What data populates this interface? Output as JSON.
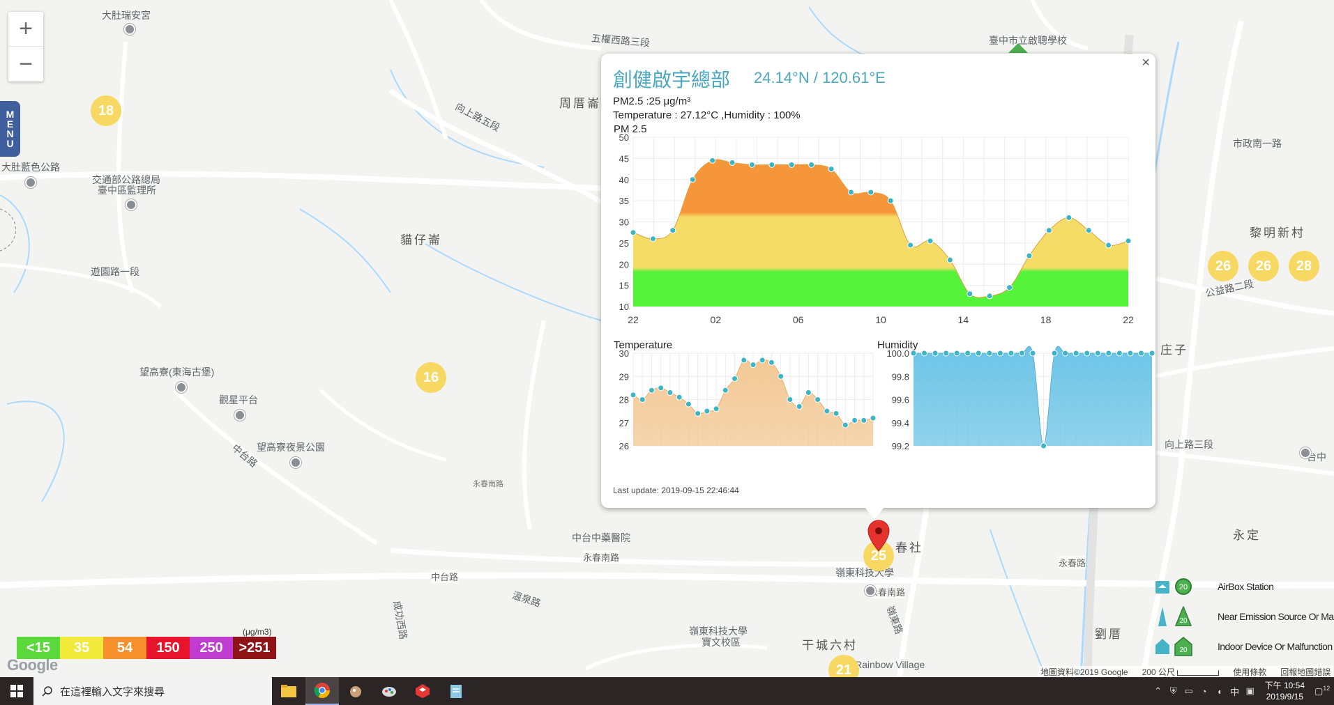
{
  "map": {
    "labels": [
      {
        "text": "大肚瑞安宮",
        "cls": ""
      },
      {
        "text": "周厝崙",
        "cls": "big"
      },
      {
        "text": "五權西路三段",
        "cls": ""
      },
      {
        "text": "臺中市立啟聰學校",
        "cls": ""
      },
      {
        "text": "向上路五段",
        "cls": ""
      },
      {
        "text": "大肚藍色公路",
        "cls": ""
      },
      {
        "text": "交通部公路總局",
        "cls": ""
      },
      {
        "text": "臺中區監理所",
        "cls": ""
      },
      {
        "text": "貓仔崙",
        "cls": "big"
      },
      {
        "text": "遊園路一段",
        "cls": ""
      },
      {
        "text": "望高寮(東海古堡)",
        "cls": ""
      },
      {
        "text": "觀星平台",
        "cls": ""
      },
      {
        "text": "望高寮夜景公園",
        "cls": ""
      },
      {
        "text": "中台路",
        "cls": ""
      },
      {
        "text": "永春南路",
        "cls": ""
      },
      {
        "text": "中台路",
        "cls": ""
      },
      {
        "text": "永春南路",
        "cls": ""
      },
      {
        "text": "春社",
        "cls": "big"
      },
      {
        "text": "嶺東科技大學",
        "cls": ""
      },
      {
        "text": "永春南路",
        "cls": ""
      },
      {
        "text": "嶺東科技大學",
        "cls": ""
      },
      {
        "text": "寶文校區",
        "cls": ""
      },
      {
        "text": "干城六村",
        "cls": "big"
      },
      {
        "text": "Rainbow Village",
        "cls": ""
      },
      {
        "text": "黎明新村",
        "cls": "big"
      },
      {
        "text": "永定",
        "cls": "big"
      },
      {
        "text": "劉厝",
        "cls": "big"
      },
      {
        "text": "庄子",
        "cls": "big"
      },
      {
        "text": "向上路三段",
        "cls": ""
      },
      {
        "text": "市政南一路",
        "cls": ""
      },
      {
        "text": "公益路二段",
        "cls": ""
      },
      {
        "text": "永春路",
        "cls": ""
      },
      {
        "text": "台中",
        "cls": ""
      },
      {
        "text": "嶺東路",
        "cls": ""
      },
      {
        "text": "中台中藥醫院",
        "cls": ""
      },
      {
        "text": "溫泉路",
        "cls": ""
      },
      {
        "text": "成功西路",
        "cls": ""
      }
    ],
    "clusters": [
      "18",
      "16",
      "26",
      "26",
      "28",
      "25",
      "21"
    ],
    "zoom_in": "+",
    "zoom_out": "−",
    "menu_letters": [
      "M",
      "E",
      "N",
      "U"
    ]
  },
  "pm_legend": {
    "unit": "(μg/m3)",
    "cells": [
      {
        "label": "<15",
        "color": "#5bd83b"
      },
      {
        "label": "35",
        "color": "#f2ea3b"
      },
      {
        "label": "54",
        "color": "#f5902c"
      },
      {
        "label": "150",
        "color": "#e8142c"
      },
      {
        "label": "250",
        "color": "#c03bd0"
      },
      {
        "label": ">251",
        "color": "#8f1217"
      }
    ]
  },
  "type_legend": {
    "icon_value": "20",
    "items": [
      {
        "label": "AirBox Station",
        "icon": "house-icon"
      },
      {
        "label": "Near Emission Source Or Malfunction",
        "icon": "tower-icon"
      },
      {
        "label": "Indoor Device Or Malfunction",
        "icon": "home-icon"
      }
    ]
  },
  "attribution": {
    "data": "地圖資料©2019 Google",
    "scale": "200 公尺",
    "terms": "使用條款",
    "report": "回報地圖錯誤"
  },
  "google_logo": "Google",
  "popup": {
    "close": "×",
    "title": "創健啟宇總部",
    "coords": "24.14°N / 120.61°E",
    "pm_line": "PM2.5 :25 μg/m³",
    "temp_line": "Temperature : 27.12°C ,Humidity : 100%",
    "pm_chart_title": "PM 2.5",
    "temp_chart_title": "Temperature",
    "hum_chart_title": "Humidity",
    "last_update": "Last update: 2019-09-15 22:46:44"
  },
  "chart_data": [
    {
      "type": "area",
      "title": "PM 2.5",
      "x_ticks": [
        "22",
        "02",
        "06",
        "10",
        "14",
        "18",
        "22"
      ],
      "ylim": [
        10,
        50
      ],
      "y_ticks": [
        10,
        15,
        20,
        25,
        30,
        35,
        40,
        45,
        50
      ],
      "values": [
        27.5,
        26,
        28,
        40,
        44.5,
        44,
        43.5,
        43.5,
        43.5,
        43.5,
        42.5,
        37,
        37,
        35,
        24.5,
        25.5,
        21,
        13,
        12.5,
        14.5,
        22,
        28,
        31,
        28,
        24.5,
        25.5
      ],
      "grid": true,
      "band_colors": [
        "#55f23a",
        "#f5dc66",
        "#f5963a"
      ]
    },
    {
      "type": "area",
      "title": "Temperature",
      "ylim": [
        26,
        30
      ],
      "y_ticks": [
        26,
        27,
        28,
        29,
        30
      ],
      "values": [
        28.2,
        28.0,
        28.4,
        28.5,
        28.3,
        28.1,
        27.8,
        27.4,
        27.5,
        27.6,
        28.4,
        28.9,
        29.7,
        29.5,
        29.7,
        29.6,
        29.0,
        28.0,
        27.7,
        28.3,
        28.0,
        27.5,
        27.4,
        26.9,
        27.1,
        27.1,
        27.2
      ],
      "grid": true,
      "color": "#f2c894"
    },
    {
      "type": "area",
      "title": "Humidity",
      "ylim": [
        99.2,
        100.0
      ],
      "y_ticks": [
        99.2,
        99.4,
        99.6,
        99.8,
        100.0
      ],
      "values": [
        100,
        100,
        100,
        100,
        100,
        100,
        100,
        100,
        100,
        100,
        100,
        100,
        99.2,
        100,
        100,
        100,
        100,
        100,
        100,
        100,
        100,
        100,
        100
      ],
      "grid": true,
      "color": "#6cc4e6"
    }
  ],
  "taskbar": {
    "search_placeholder": "在這裡輸入文字來搜尋",
    "apps": [
      "file-explorer-icon",
      "chrome-icon",
      "app-icon",
      "paint-icon",
      "sketchup-icon",
      "notepad-icon"
    ],
    "ime": "中",
    "time": "下午 10:54",
    "date": "2019/9/15",
    "notifications": "12"
  }
}
